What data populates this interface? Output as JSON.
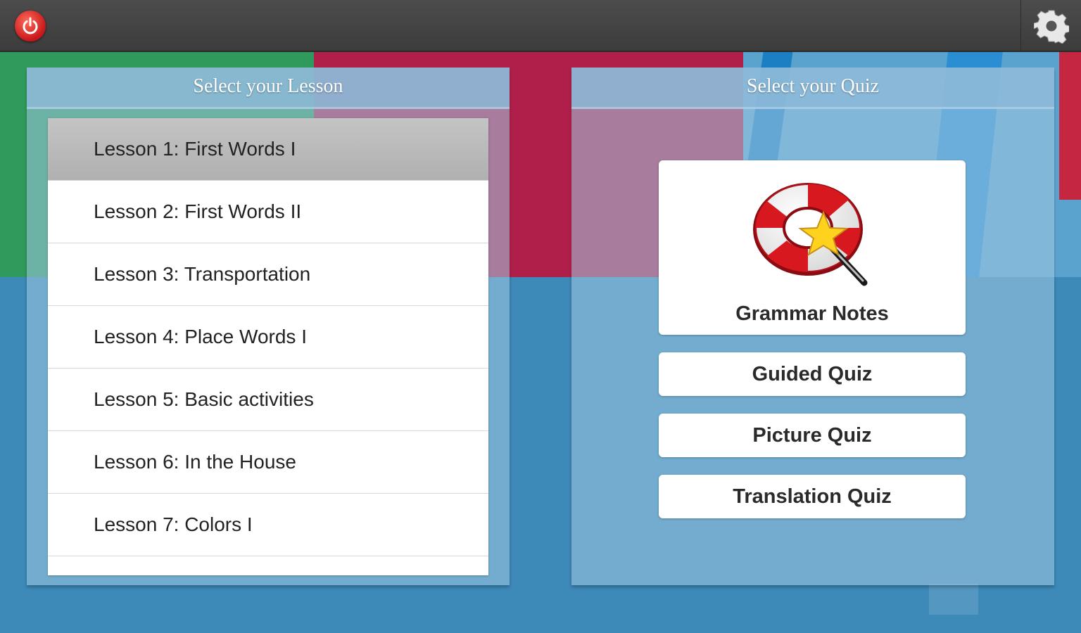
{
  "topbar": {
    "power_icon": "power-icon",
    "settings_icon": "gear-icon"
  },
  "lessons": {
    "title": "Select your Lesson",
    "items": [
      {
        "label": "Lesson 1: First Words I",
        "selected": true
      },
      {
        "label": "Lesson 2: First Words II",
        "selected": false
      },
      {
        "label": "Lesson 3: Transportation",
        "selected": false
      },
      {
        "label": "Lesson 4: Place Words I",
        "selected": false
      },
      {
        "label": "Lesson 5: Basic activities",
        "selected": false
      },
      {
        "label": "Lesson 6: In the House",
        "selected": false
      },
      {
        "label": "Lesson 7: Colors I",
        "selected": false
      }
    ]
  },
  "quiz": {
    "title": "Select your Quiz",
    "grammar_notes": "Grammar Notes",
    "grammar_icon": "lifebuoy-star-wand-icon",
    "guided": "Guided Quiz",
    "picture": "Picture Quiz",
    "translation": "Translation Quiz"
  },
  "colors": {
    "topbar": "#444444",
    "accent_red": "#b01f4a",
    "accent_green": "#2f9a5c",
    "background_blue": "#3d89b8"
  }
}
